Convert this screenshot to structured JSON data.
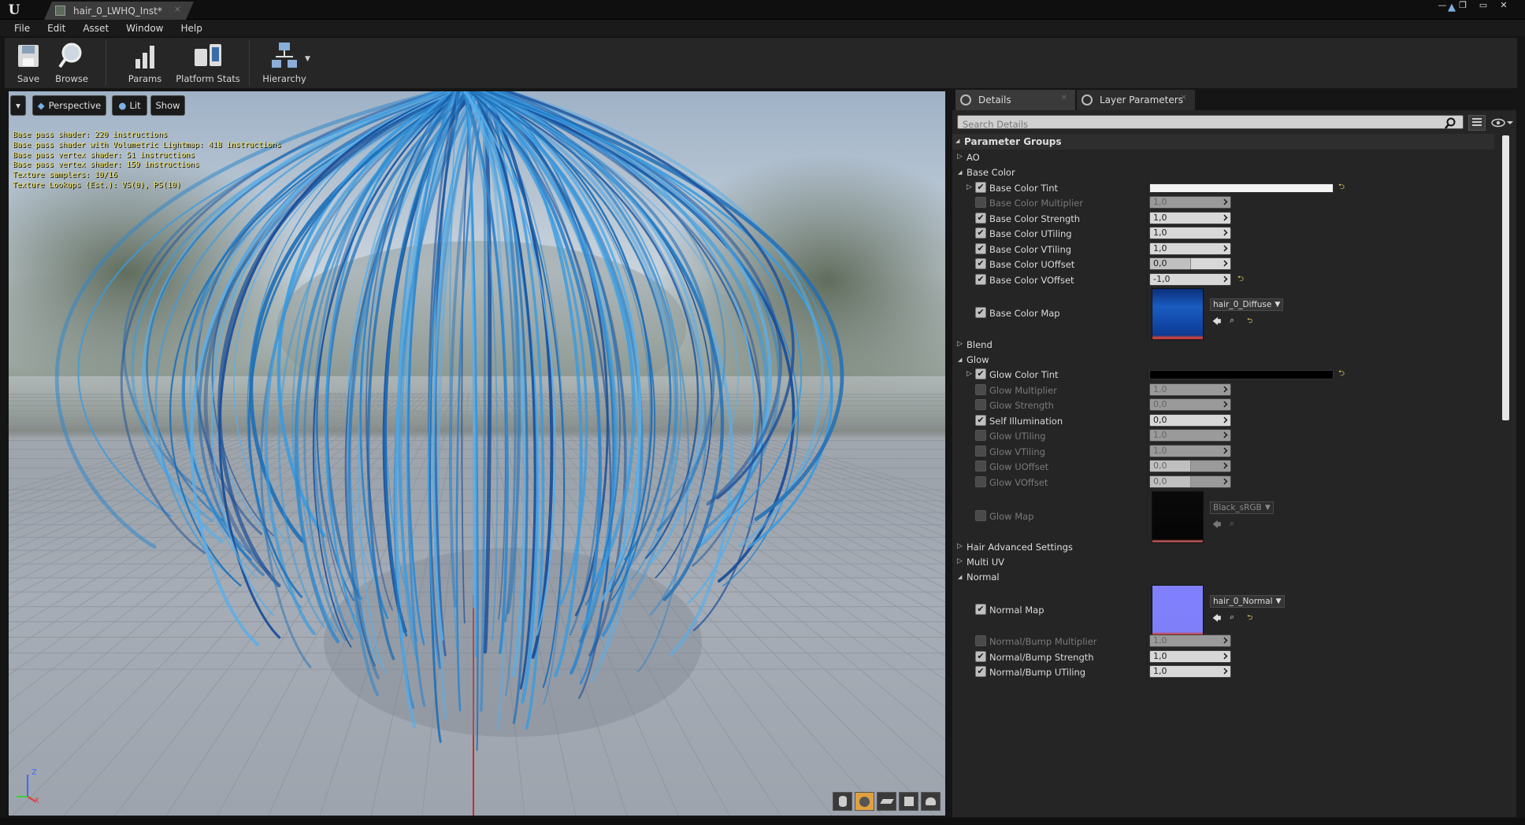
{
  "window": {
    "tab_title": "hair_0_LWHQ_Inst*",
    "close_glyph": "×",
    "controls": [
      "—",
      "❐",
      "▭",
      "✕"
    ]
  },
  "menu": [
    "File",
    "Edit",
    "Asset",
    "Window",
    "Help"
  ],
  "toolbar": {
    "save": "Save",
    "browse": "Browse",
    "params": "Params",
    "platform_stats": "Platform Stats",
    "hierarchy": "Hierarchy"
  },
  "viewport": {
    "menu_glyph": "▾",
    "perspective": "Perspective",
    "lit": "Lit",
    "show": "Show",
    "stats": [
      "Base pass shader: 220 instructions",
      "Base pass shader with Volumetric Lightmap: 418 instructions",
      "Base pass vertex shader: 51 instructions",
      "Base pass vertex shader: 159 instructions",
      "Texture samplers: 10/16",
      "Texture Lookups (Est.): VS(0), PS(10)"
    ],
    "axis": {
      "x": "X",
      "z": "Z"
    }
  },
  "details": {
    "tab_details": "Details",
    "tab_layer": "Layer Parameters",
    "search_placeholder": "Search Details",
    "parameter_groups": "Parameter Groups",
    "groups": {
      "ao": "AO",
      "base_color": "Base Color",
      "blend": "Blend",
      "glow": "Glow",
      "hair_adv": "Hair Advanced Settings",
      "multi_uv": "Multi UV",
      "normal": "Normal"
    },
    "params": {
      "bc_tint": {
        "label": "Base Color Tint",
        "color": "#f4f4f4"
      },
      "bc_mult": {
        "label": "Base Color Multiplier",
        "value": "1,0"
      },
      "bc_strength": {
        "label": "Base Color Strength",
        "value": "1,0"
      },
      "bc_utiling": {
        "label": "Base Color UTiling",
        "value": "1,0"
      },
      "bc_vtiling": {
        "label": "Base Color VTiling",
        "value": "1,0"
      },
      "bc_uoffset": {
        "label": "Base Color UOffset",
        "value": "0,0"
      },
      "bc_voffset": {
        "label": "Base Color VOffset",
        "value": "-1,0"
      },
      "bc_map": {
        "label": "Base Color Map",
        "texture": "hair_0_Diffuse"
      },
      "glow_tint": {
        "label": "Glow Color Tint",
        "color": "#000000"
      },
      "glow_mult": {
        "label": "Glow Multiplier",
        "value": "1,0"
      },
      "glow_strength": {
        "label": "Glow Strength",
        "value": "0,0"
      },
      "self_illum": {
        "label": "Self Illumination",
        "value": "0,0"
      },
      "glow_utiling": {
        "label": "Glow UTiling",
        "value": "1,0"
      },
      "glow_vtiling": {
        "label": "Glow VTiling",
        "value": "1,0"
      },
      "glow_uoffset": {
        "label": "Glow UOffset",
        "value": "0,0"
      },
      "glow_voffset": {
        "label": "Glow VOffset",
        "value": "0,0"
      },
      "glow_map": {
        "label": "Glow Map",
        "texture": "Black_sRGB"
      },
      "normal_map": {
        "label": "Normal Map",
        "texture": "hair_0_Normal"
      },
      "nb_mult": {
        "label": "Normal/Bump Multiplier",
        "value": "1,0"
      },
      "nb_strength": {
        "label": "Normal/Bump Strength",
        "value": "1,0"
      },
      "nb_utiling": {
        "label": "Normal/Bump UTiling",
        "value": "1,0"
      }
    }
  },
  "colors": {
    "hair": "#1e6fb8",
    "hair_light": "#3a9be0",
    "accent": "#e8d060"
  }
}
